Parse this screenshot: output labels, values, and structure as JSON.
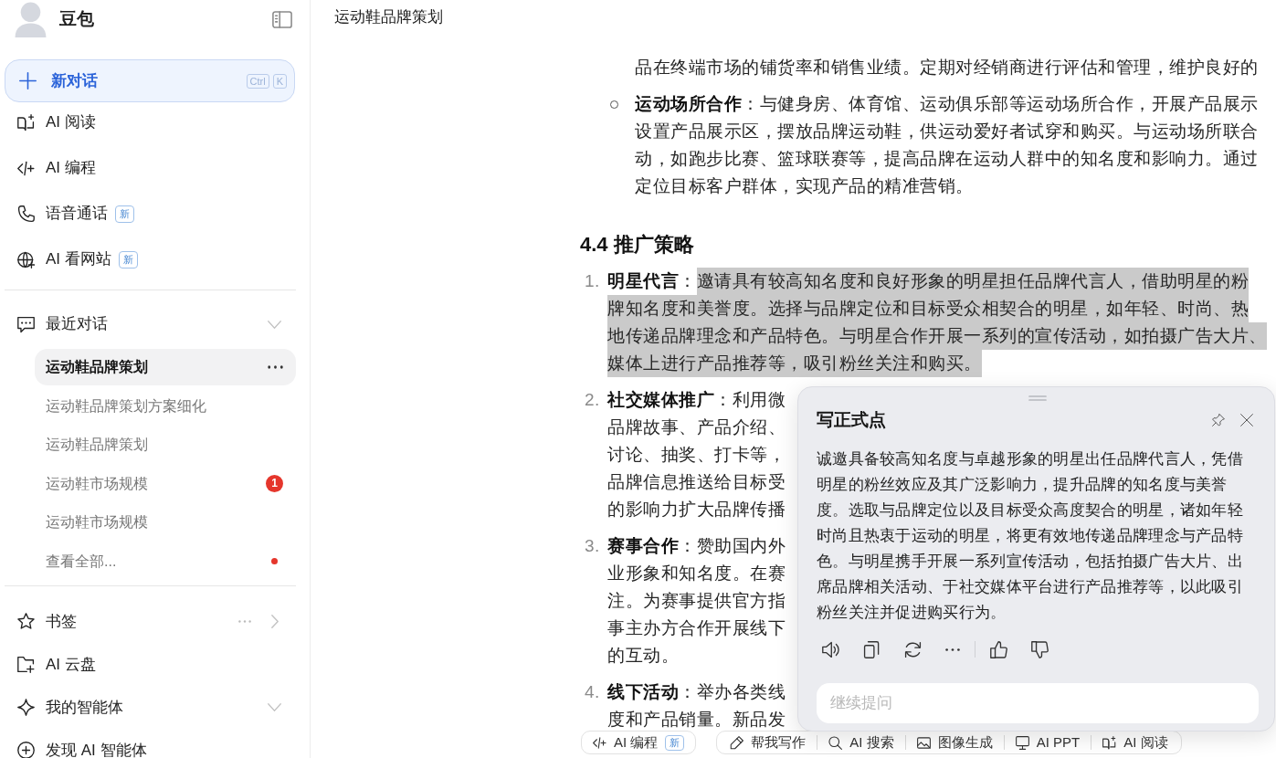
{
  "sidebar": {
    "app_name": "豆包",
    "new_chat": {
      "label": "新对话",
      "shortcut": [
        "Ctrl",
        "K"
      ]
    },
    "nav_items": [
      {
        "label": "AI 阅读"
      },
      {
        "label": "AI 编程"
      },
      {
        "label": "语音通话",
        "badge": "新"
      },
      {
        "label": "AI 看网站",
        "badge": "新"
      }
    ],
    "recent": {
      "title": "最近对话",
      "conversations": [
        {
          "title": "运动鞋品牌策划",
          "selected": true
        },
        {
          "title": "运动鞋品牌策划方案细化",
          "selected": false
        },
        {
          "title": "运动鞋品牌策划",
          "selected": false
        },
        {
          "title": "运动鞋市场规模",
          "selected": false,
          "badge": "1"
        },
        {
          "title": "运动鞋市场规模",
          "selected": false
        }
      ],
      "view_all": {
        "label": "查看全部...",
        "unread": true
      }
    },
    "bottom_items": [
      {
        "label": "书签"
      },
      {
        "label": "AI 云盘"
      },
      {
        "label": "我的智能体"
      },
      {
        "label": "发现 AI 智能体"
      }
    ]
  },
  "header": {
    "title": "运动鞋品牌策划"
  },
  "document": [
    {
      "kind": "text",
      "lines": [
        "品在终端市场的铺货率和销售业绩。定期对经销商进行评估和管理，维护良好的"
      ]
    },
    {
      "kind": "bullet",
      "title": "**运动场所合作**：",
      "lines": [
        "与健身房、体育馆、运动俱乐部等运动场所合作，开展产品展示",
        "设置产品展示区，摆放品牌运动鞋，供运动爱好者试穿和购买。与运动场所联合",
        "动，如跑步比赛、篮球联赛等，提高品牌在运动人群中的知名度和影响力。通过",
        "定位目标客户群体，实现产品的精准营销。"
      ]
    },
    {
      "kind": "heading",
      "text": "4.4 推广策略"
    },
    {
      "kind": "numbered",
      "number": "1.",
      "title": "**明星代言**：",
      "highlighted": true,
      "lines": [
        "邀请具有较高知名度和良好形象的明星担任品牌代言人，借助明星的粉",
        "牌知名度和美誉度。选择与品牌定位和目标受众相契合的明星，如年轻、时尚、热",
        "地传递品牌理念和产品特色。与明星合作开展一系列的宣传活动，如拍摄广告大片、",
        "媒体上进行产品推荐等，吸引粉丝关注和购买。"
      ]
    },
    {
      "kind": "numbered",
      "number": "2.",
      "title": "**社交媒体推广**：",
      "highlighted": false,
      "lines": [
        "利用微",
        "品牌故事、产品介绍、",
        "讨论、抽奖、打卡等，",
        "品牌信息推送给目标受",
        "的影响力扩大品牌传播"
      ]
    },
    {
      "kind": "numbered",
      "number": "3.",
      "title": "**赛事合作**：",
      "highlighted": false,
      "lines": [
        "赞助国内外",
        "业形象和知名度。在赛",
        "注。为赛事提供官方指",
        "事主办方合作开展线下",
        "的互动。"
      ]
    },
    {
      "kind": "numbered",
      "number": "4.",
      "title": "**线下活动**：",
      "highlighted": false,
      "lines": [
        "举办各类线",
        "度和产品销量。新品发"
      ]
    }
  ],
  "toolbar": [
    {
      "label": "AI 编程",
      "badge": "新"
    },
    {
      "label": "帮我写作"
    },
    {
      "label": "AI 搜索"
    },
    {
      "label": "图像生成"
    },
    {
      "label": "AI PPT"
    },
    {
      "label": "AI 阅读"
    }
  ],
  "popup": {
    "title": "写正式点",
    "text": "诚邀具备较高知名度与卓越形象的明星出任品牌代言人，凭借明星的粉丝效应及其广泛影响力，提升品牌的知名度与美誉度。选取与品牌定位以及目标受众高度契合的明星，诸如年轻时尚且热衷于运动的明星，将更有效地传递品牌理念与产品特色。与明星携手开展一系列宣传活动，包括拍摄广告大片、出席品牌相关活动、于社交媒体平台进行产品推荐等，以此吸引粉丝关注并促进购买行为。",
    "input": {
      "placeholder": "继续提问"
    }
  }
}
